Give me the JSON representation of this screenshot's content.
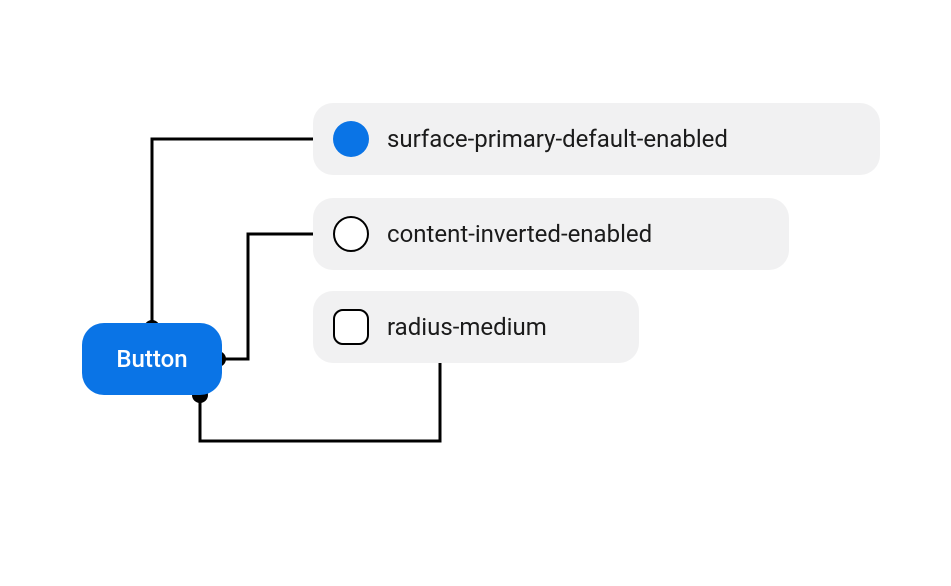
{
  "colors": {
    "primary": "#0a74e6",
    "pillBg": "#f1f1f2",
    "line": "#000000"
  },
  "button": {
    "label": "Button"
  },
  "tokens": [
    {
      "label": "surface-primary-default-enabled",
      "swatch": {
        "shape": "circle",
        "fill": "#0a74e6",
        "outline": false
      }
    },
    {
      "label": "content-inverted-enabled",
      "swatch": {
        "shape": "circle",
        "fill": "#ffffff",
        "outline": true
      }
    },
    {
      "label": "radius-medium",
      "swatch": {
        "shape": "rounded-square",
        "fill": "#ffffff",
        "outline": true
      }
    }
  ]
}
